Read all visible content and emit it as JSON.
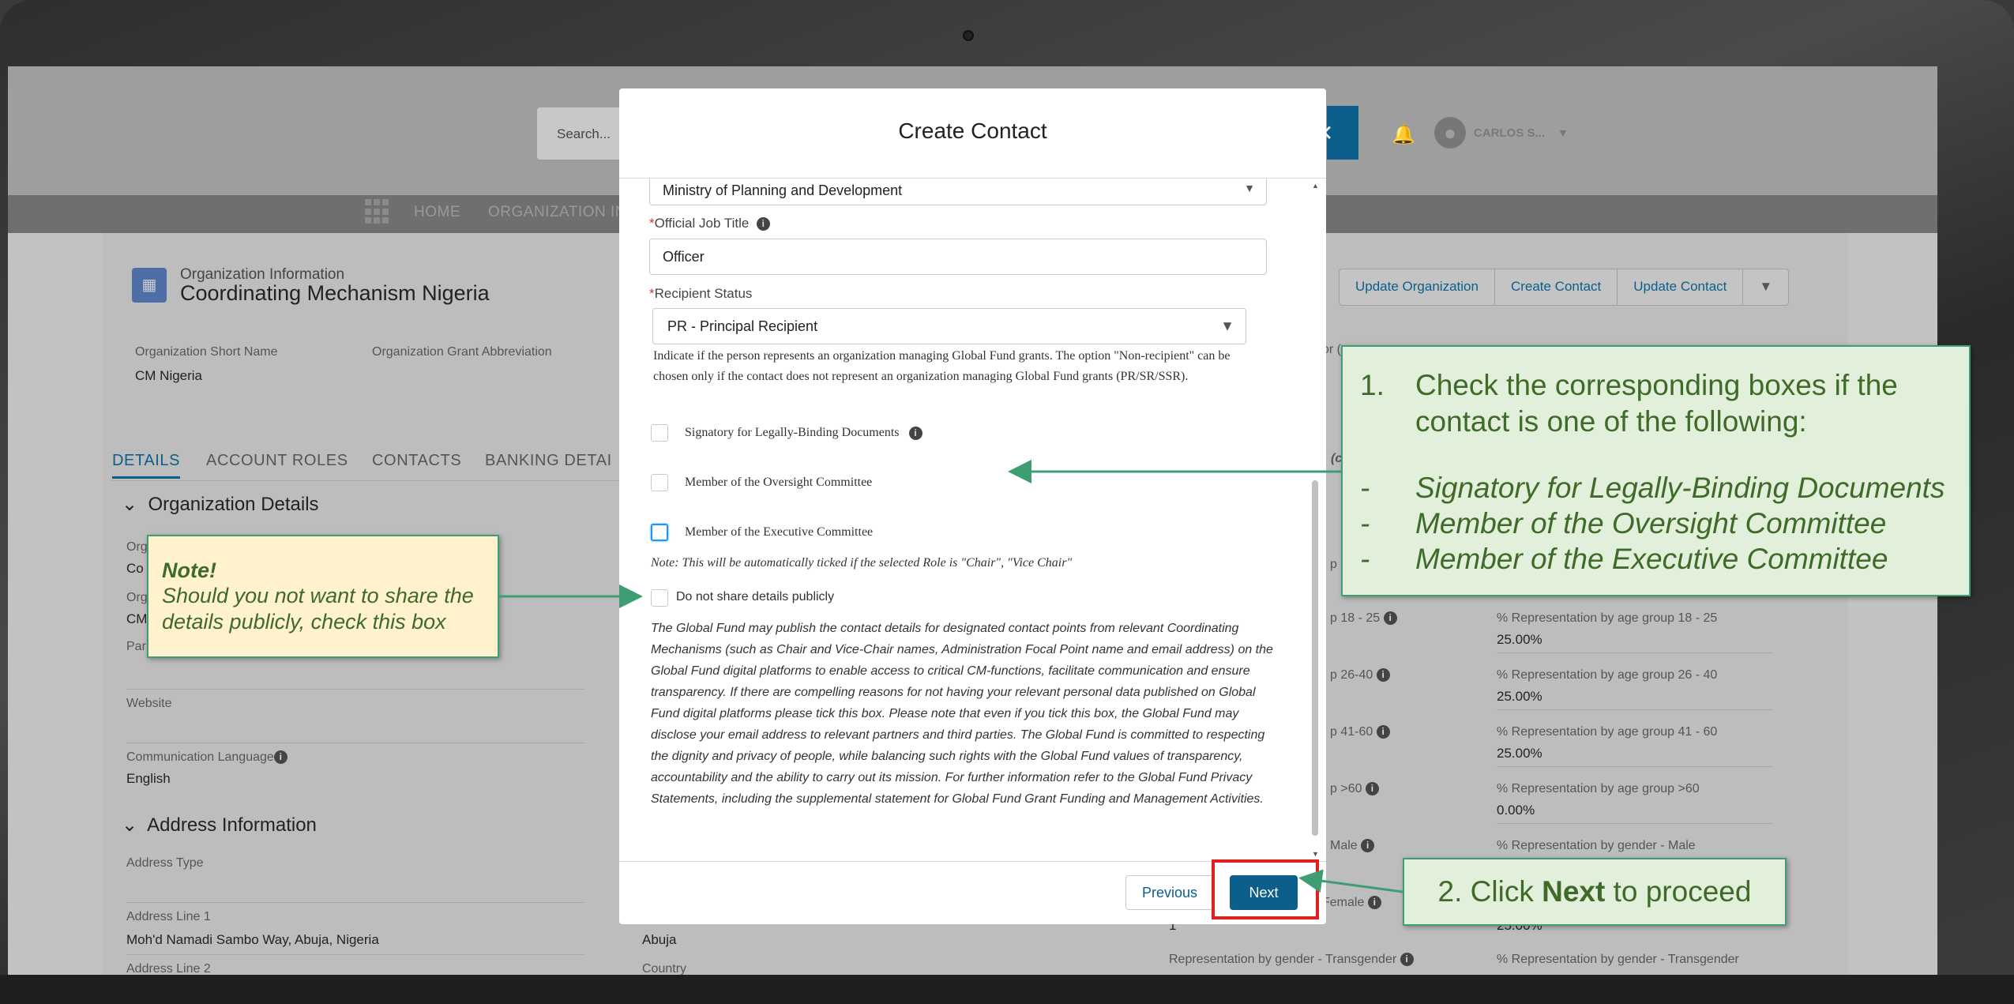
{
  "app": {
    "search_placeholder": "Search...",
    "username": "CARLOS S...",
    "nav": [
      "HOME",
      "ORGANIZATION IN"
    ],
    "org_subtitle": "Organization Information",
    "org_title": "Coordinating Mechanism Nigeria",
    "short_name_label": "Organization Short Name",
    "short_name_value": "CM Nigeria",
    "grant_abbrev_label": "Organization Grant Abbreviation",
    "tabs": [
      "DETAILS",
      "ACCOUNT ROLES",
      "CONTACTS",
      "BANKING DETAI"
    ],
    "actions": [
      "Update Organization",
      "Create Contact",
      "Update Contact"
    ],
    "section_org_details": "Organization Details",
    "section_address": "Address Information",
    "fields": {
      "org1_label": "Org",
      "org1_value": "Co",
      "org2_label": "Org",
      "org2_value": "CM",
      "par_label": "Par",
      "website_label": "Website",
      "comm_lang_label": "Communication Language",
      "comm_lang_value": "English",
      "address_type_label": "Address Type",
      "address_line1_label": "Address Line 1",
      "address_line1_value": "Moh'd Namadi Sambo Way, Abuja, Nigeria",
      "address_line2_label": "Address Line 2",
      "city_value": "Abuja",
      "country_label": "Country"
    },
    "right_panel": {
      "p1": "p 18 - 25",
      "l1": "% Representation by age group 18 - 25",
      "v1": "25.00%",
      "p2": "p 26-40",
      "l2": "% Representation by age group 26 - 40",
      "v2": "25.00%",
      "p3": "p 41-60",
      "l3": "% Representation by age group 41 - 60",
      "v3": "25.00%",
      "p4": "p >60",
      "l4": "% Representation by age group >60",
      "v4": "0.00%",
      "p5": "Male",
      "l5": "% Representation by gender - Male",
      "p6": "Female",
      "v6a": "1",
      "v6b": "25.00%",
      "p7": "Representation by gender - Transgender",
      "l7": "% Representation by gender - Transgender",
      "partial1": "p <",
      "partial2": "or (",
      "partial3": "(c"
    }
  },
  "modal": {
    "title": "Create Contact",
    "organization_value": "Ministry of Planning and Development",
    "job_title_label": "Official Job Title",
    "job_title_value": "Officer",
    "recipient_status_label": "Recipient Status",
    "recipient_status_value": "PR - Principal Recipient",
    "recipient_help": "Indicate if the person represents an organization managing Global Fund grants. The option \"Non-recipient\" can be chosen only if the contact does not represent an organization managing Global Fund grants (PR/SR/SSR).",
    "cb_signatory": "Signatory for Legally-Binding Documents",
    "cb_oversight": "Member of the Oversight Committee",
    "cb_executive": "Member of the Executive Committee",
    "auto_note": "Note: This will be automatically ticked if the selected Role is \"Chair\", \"Vice Chair\"",
    "cb_privacy": "Do not share details publicly",
    "privacy_text": "The Global Fund may publish the contact details for designated contact points from relevant Coordinating Mechanisms (such as Chair and Vice-Chair names, Administration Focal Point name and email address) on the Global Fund digital platforms to enable access to critical CM-functions, facilitate communication and ensure transparency. If there are compelling reasons for not having your relevant personal data published on Global Fund digital platforms please tick this box. Please note that even if you tick this box, the Global Fund may disclose your email address to relevant partners and third parties. The Global Fund is committed to respecting the dignity and privacy of people, while balancing such rights with the Global Fund values of transparency, accountability and the ability to carry out its mission. For further information refer to the Global Fund Privacy Statements, including the supplemental statement for Global Fund Grant Funding and Management Activities.",
    "previous_label": "Previous",
    "next_label": "Next"
  },
  "callouts": {
    "note_title": "Note!",
    "note_text": "Should you not want to share the details publicly, check this box",
    "step1_num": "1.",
    "step1_text": "Check the corresponding boxes if the contact is one of the following:",
    "step1_items": [
      "Signatory for Legally-Binding Documents",
      "Member of the Oversight Committee",
      "Member of the Executive Committee"
    ],
    "step2_prefix": "2. Click ",
    "step2_bold": "Next",
    "step2_suffix": " to proceed"
  },
  "colors": {
    "accent": "#0b5f8a",
    "callout_bg": "#e2efda",
    "callout_border": "#3f9d73",
    "note_bg": "#fff2cc",
    "highlight": "#e0201e"
  }
}
